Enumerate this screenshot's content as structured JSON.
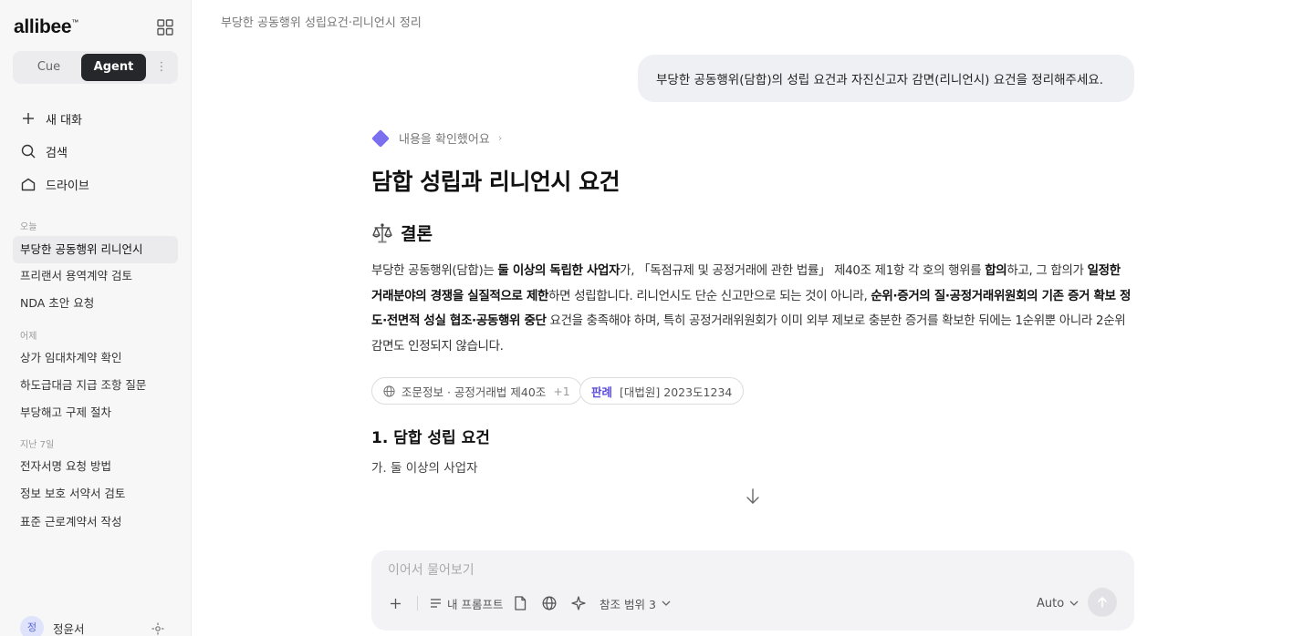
{
  "sidebar": {
    "logo": "allibee",
    "logo_mark": "™",
    "mode": {
      "cue": "Cue",
      "agent": "Agent",
      "more": "⋮"
    },
    "nav": [
      {
        "label": "새 대화",
        "icon": "plus-icon"
      },
      {
        "label": "검색",
        "icon": "search-icon"
      },
      {
        "label": "드라이브",
        "icon": "folder-icon"
      }
    ],
    "sections": [
      {
        "label": "오늘",
        "items": [
          "부당한 공동행위 리니언시",
          "프리랜서 용역계약 검토",
          "NDA 초안 요청"
        ]
      },
      {
        "label": "어제",
        "items": [
          "상가 임대차계약 확인",
          "하도급대금 지급 조항 질문",
          "부당해고 구제 절차"
        ]
      },
      {
        "label": "지난 7일",
        "items": [
          "전자서명 요청 방법",
          "정보 보호 서약서 검토",
          "표준 근로계약서 작성"
        ]
      }
    ],
    "user": {
      "avatar_text": "정",
      "name": "정윤서"
    }
  },
  "main": {
    "breadcrumb": "부당한 공동행위 성립요건·리니언시 정리",
    "user_message": "부당한 공동행위(담합)의 성립 요건과 자진신고자 감면(리니언시) 요건을 정리해주세요.",
    "status": "내용을 확인했어요",
    "status_chevron": "›",
    "title": "담합 성립과 리니언시 요건",
    "conclusion_heading": "결론",
    "paragraph": {
      "p1": "부당한 공동행위(담합)는 ",
      "b1": "둘 이상의 독립한 사업자",
      "p2": "가, 「독점규제 및 공정거래에 관한 법률」 제40조 제1항 각 호의 행위를 ",
      "b2": "합의",
      "p3": "하고, 그 합의가 ",
      "b3": "일정한 거래분야의 경쟁을 실질적으로 제한",
      "p4": "하면 성립합니다. 리니언시도 단순 신고만으로 되는 것이 아니라, ",
      "b4": "순위·증거의 질·공정거래위원회의 기존 증거 확보 정도·전면적 성실 협조·공동행위 중단",
      "p5": " 요건을 충족해야 하며, 특히 공정거래위원회가 이미 외부 제보로 충분한 증거를 확보한 뒤에는 1순위뿐 아니라 2순위 감면도 인정되지 않습니다."
    },
    "chips": [
      {
        "label": "조문정보 · 공정거래법 제40조",
        "extra": "+1",
        "icon": "globe-icon"
      },
      {
        "tag": "판례",
        "label": "[대법원] 2023도1234"
      }
    ],
    "section_heading": "1. 담합 성립 요건",
    "sub_item": "가. 둘 이상의 사업자"
  },
  "composer": {
    "placeholder": "이어서 물어보기",
    "my_prompt": "내 프롬프트",
    "scope": "참조 범위 3",
    "model": "Auto"
  },
  "colors": {
    "accent": "#7b6ff0",
    "agent_bg": "#26272b",
    "sidebar_bg": "#f7f7f8",
    "bubble_bg": "#eef0f4"
  }
}
